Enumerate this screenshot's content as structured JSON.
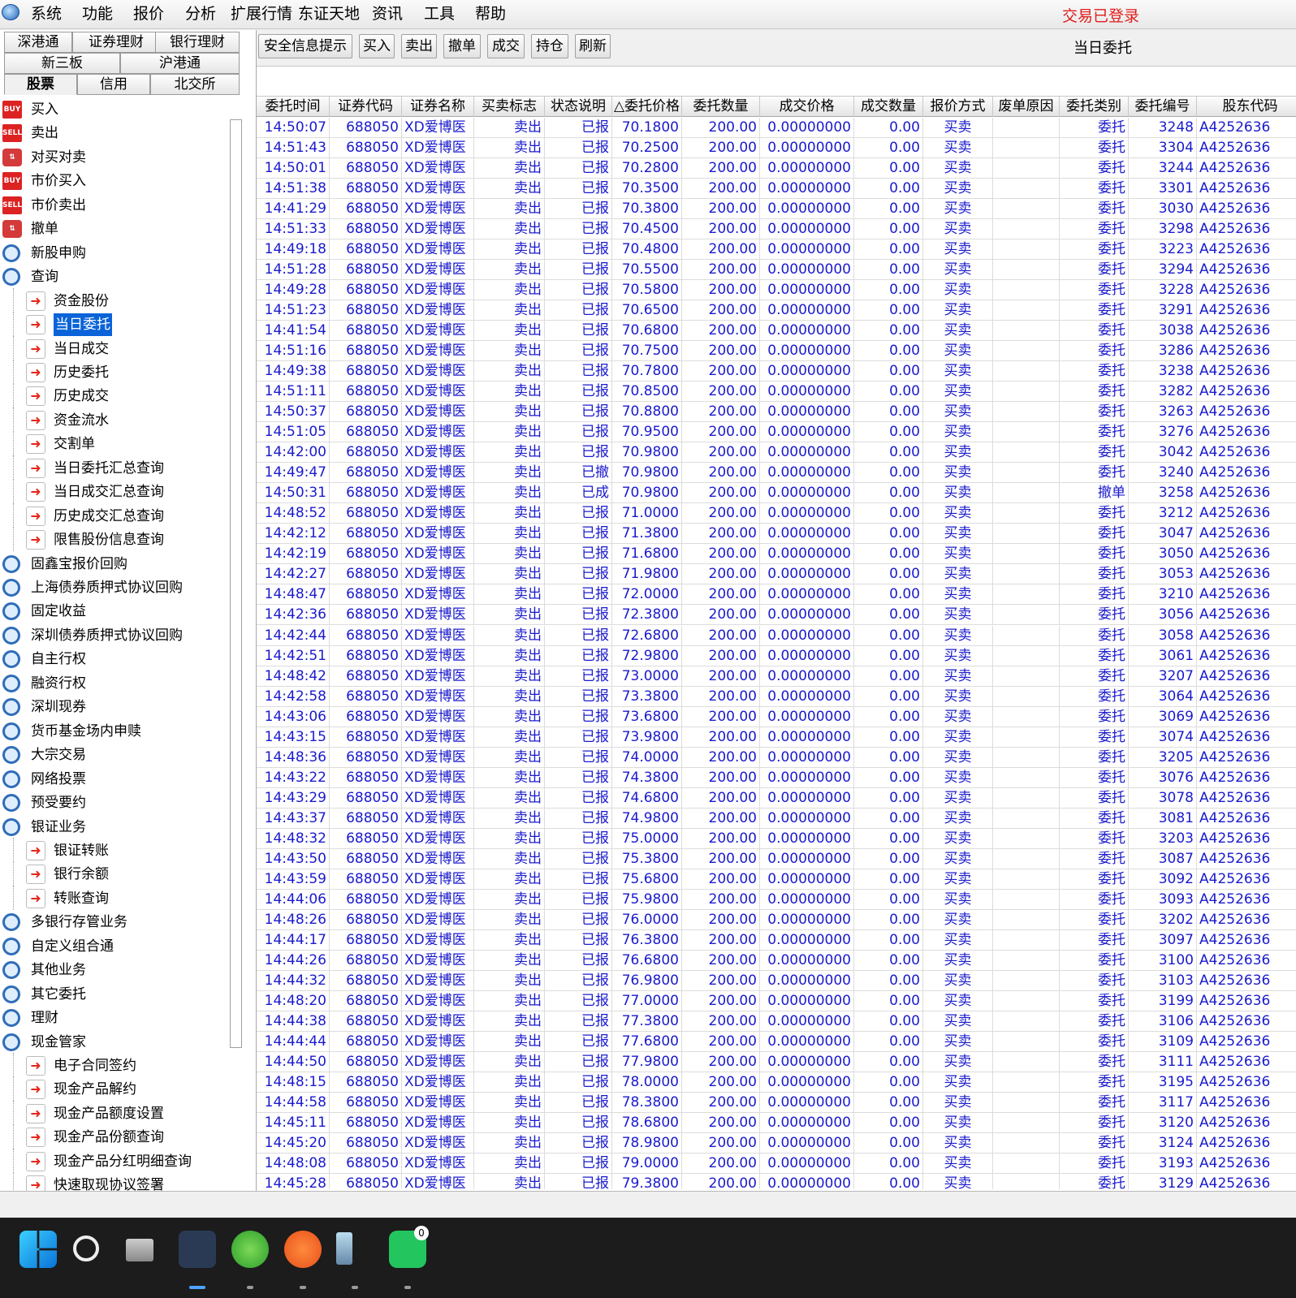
{
  "menu": {
    "items": [
      "系统",
      "功能",
      "报价",
      "分析",
      "扩展行情",
      "东证天地",
      "资讯",
      "工具",
      "帮助"
    ],
    "login_status": "交易已登录"
  },
  "tabs": {
    "row1": [
      "深港通",
      "证券理财",
      "银行理财"
    ],
    "row2": [
      "新三板",
      "沪港通"
    ],
    "row3": [
      "股票",
      "信用",
      "北交所"
    ],
    "active": "股票"
  },
  "tree": [
    {
      "label": "买入",
      "icon": "buy",
      "level": 0
    },
    {
      "label": "卖出",
      "icon": "sell",
      "level": 0
    },
    {
      "label": "对买对卖",
      "icon": "other",
      "level": 0
    },
    {
      "label": "市价买入",
      "icon": "buy",
      "level": 0
    },
    {
      "label": "市价卖出",
      "icon": "sell",
      "level": 0
    },
    {
      "label": "撤单",
      "icon": "other",
      "level": 0
    },
    {
      "label": "新股申购",
      "icon": "mag",
      "level": 0
    },
    {
      "label": "查询",
      "icon": "mag",
      "level": 0
    },
    {
      "label": "资金股份",
      "icon": "arrow",
      "level": 1
    },
    {
      "label": "当日委托",
      "icon": "arrow",
      "level": 1,
      "selected": true
    },
    {
      "label": "当日成交",
      "icon": "arrow",
      "level": 1
    },
    {
      "label": "历史委托",
      "icon": "arrow",
      "level": 1
    },
    {
      "label": "历史成交",
      "icon": "arrow",
      "level": 1
    },
    {
      "label": "资金流水",
      "icon": "arrow",
      "level": 1
    },
    {
      "label": "交割单",
      "icon": "arrow",
      "level": 1
    },
    {
      "label": "当日委托汇总查询",
      "icon": "arrow",
      "level": 1
    },
    {
      "label": "当日成交汇总查询",
      "icon": "arrow",
      "level": 1
    },
    {
      "label": "历史成交汇总查询",
      "icon": "arrow",
      "level": 1
    },
    {
      "label": "限售股份信息查询",
      "icon": "arrow",
      "level": 1
    },
    {
      "label": "固鑫宝报价回购",
      "icon": "mag",
      "level": 0
    },
    {
      "label": "上海债券质押式协议回购",
      "icon": "mag",
      "level": 0
    },
    {
      "label": "固定收益",
      "icon": "mag",
      "level": 0
    },
    {
      "label": "深圳债券质押式协议回购",
      "icon": "mag",
      "level": 0
    },
    {
      "label": "自主行权",
      "icon": "mag",
      "level": 0
    },
    {
      "label": "融资行权",
      "icon": "mag",
      "level": 0
    },
    {
      "label": "深圳现券",
      "icon": "mag",
      "level": 0
    },
    {
      "label": "货币基金场内申赎",
      "icon": "mag",
      "level": 0
    },
    {
      "label": "大宗交易",
      "icon": "mag",
      "level": 0
    },
    {
      "label": "网络投票",
      "icon": "mag",
      "level": 0
    },
    {
      "label": "预受要约",
      "icon": "mag",
      "level": 0
    },
    {
      "label": "银证业务",
      "icon": "mag",
      "level": 0
    },
    {
      "label": "银证转账",
      "icon": "arrow",
      "level": 1
    },
    {
      "label": "银行余额",
      "icon": "arrow",
      "level": 1
    },
    {
      "label": "转账查询",
      "icon": "arrow",
      "level": 1
    },
    {
      "label": "多银行存管业务",
      "icon": "mag",
      "level": 0
    },
    {
      "label": "自定义组合通",
      "icon": "mag",
      "level": 0
    },
    {
      "label": "其他业务",
      "icon": "mag",
      "level": 0
    },
    {
      "label": "其它委托",
      "icon": "mag",
      "level": 0
    },
    {
      "label": "理财",
      "icon": "mag",
      "level": 0
    },
    {
      "label": "现金管家",
      "icon": "mag",
      "level": 0
    },
    {
      "label": "电子合同签约",
      "icon": "arrow",
      "level": 1
    },
    {
      "label": "现金产品解约",
      "icon": "arrow",
      "level": 1
    },
    {
      "label": "现金产品额度设置",
      "icon": "arrow",
      "level": 1
    },
    {
      "label": "现金产品份额查询",
      "icon": "arrow",
      "level": 1
    },
    {
      "label": "现金产品分红明细查询",
      "icon": "arrow",
      "level": 1
    },
    {
      "label": "快速取现协议签署",
      "icon": "arrow",
      "level": 1
    }
  ],
  "toolbar": {
    "buttons": [
      "安全信息提示",
      "买入",
      "卖出",
      "撤单",
      "成交",
      "持仓",
      "刷新"
    ],
    "title": "当日委托"
  },
  "table": {
    "headers": [
      "委托时间",
      "证券代码",
      "证券名称",
      "买卖标志",
      "状态说明",
      "△委托价格",
      "委托数量",
      "成交价格",
      "成交数量",
      "报价方式",
      "废单原因",
      "委托类别",
      "委托编号",
      "股东代码"
    ],
    "rows": [
      [
        "14:50:07",
        "688050",
        "XD爱博医",
        "卖出",
        "已报",
        "70.1800",
        "200.00",
        "0.00000000",
        "0.00",
        "买卖",
        "",
        "委托",
        "3248",
        "A4252636"
      ],
      [
        "14:51:43",
        "688050",
        "XD爱博医",
        "卖出",
        "已报",
        "70.2500",
        "200.00",
        "0.00000000",
        "0.00",
        "买卖",
        "",
        "委托",
        "3304",
        "A4252636"
      ],
      [
        "14:50:01",
        "688050",
        "XD爱博医",
        "卖出",
        "已报",
        "70.2800",
        "200.00",
        "0.00000000",
        "0.00",
        "买卖",
        "",
        "委托",
        "3244",
        "A4252636"
      ],
      [
        "14:51:38",
        "688050",
        "XD爱博医",
        "卖出",
        "已报",
        "70.3500",
        "200.00",
        "0.00000000",
        "0.00",
        "买卖",
        "",
        "委托",
        "3301",
        "A4252636"
      ],
      [
        "14:41:29",
        "688050",
        "XD爱博医",
        "卖出",
        "已报",
        "70.3800",
        "200.00",
        "0.00000000",
        "0.00",
        "买卖",
        "",
        "委托",
        "3030",
        "A4252636"
      ],
      [
        "14:51:33",
        "688050",
        "XD爱博医",
        "卖出",
        "已报",
        "70.4500",
        "200.00",
        "0.00000000",
        "0.00",
        "买卖",
        "",
        "委托",
        "3298",
        "A4252636"
      ],
      [
        "14:49:18",
        "688050",
        "XD爱博医",
        "卖出",
        "已报",
        "70.4800",
        "200.00",
        "0.00000000",
        "0.00",
        "买卖",
        "",
        "委托",
        "3223",
        "A4252636"
      ],
      [
        "14:51:28",
        "688050",
        "XD爱博医",
        "卖出",
        "已报",
        "70.5500",
        "200.00",
        "0.00000000",
        "0.00",
        "买卖",
        "",
        "委托",
        "3294",
        "A4252636"
      ],
      [
        "14:49:28",
        "688050",
        "XD爱博医",
        "卖出",
        "已报",
        "70.5800",
        "200.00",
        "0.00000000",
        "0.00",
        "买卖",
        "",
        "委托",
        "3228",
        "A4252636"
      ],
      [
        "14:51:23",
        "688050",
        "XD爱博医",
        "卖出",
        "已报",
        "70.6500",
        "200.00",
        "0.00000000",
        "0.00",
        "买卖",
        "",
        "委托",
        "3291",
        "A4252636"
      ],
      [
        "14:41:54",
        "688050",
        "XD爱博医",
        "卖出",
        "已报",
        "70.6800",
        "200.00",
        "0.00000000",
        "0.00",
        "买卖",
        "",
        "委托",
        "3038",
        "A4252636"
      ],
      [
        "14:51:16",
        "688050",
        "XD爱博医",
        "卖出",
        "已报",
        "70.7500",
        "200.00",
        "0.00000000",
        "0.00",
        "买卖",
        "",
        "委托",
        "3286",
        "A4252636"
      ],
      [
        "14:49:38",
        "688050",
        "XD爱博医",
        "卖出",
        "已报",
        "70.7800",
        "200.00",
        "0.00000000",
        "0.00",
        "买卖",
        "",
        "委托",
        "3238",
        "A4252636"
      ],
      [
        "14:51:11",
        "688050",
        "XD爱博医",
        "卖出",
        "已报",
        "70.8500",
        "200.00",
        "0.00000000",
        "0.00",
        "买卖",
        "",
        "委托",
        "3282",
        "A4252636"
      ],
      [
        "14:50:37",
        "688050",
        "XD爱博医",
        "卖出",
        "已报",
        "70.8800",
        "200.00",
        "0.00000000",
        "0.00",
        "买卖",
        "",
        "委托",
        "3263",
        "A4252636"
      ],
      [
        "14:51:05",
        "688050",
        "XD爱博医",
        "卖出",
        "已报",
        "70.9500",
        "200.00",
        "0.00000000",
        "0.00",
        "买卖",
        "",
        "委托",
        "3276",
        "A4252636"
      ],
      [
        "14:42:00",
        "688050",
        "XD爱博医",
        "卖出",
        "已报",
        "70.9800",
        "200.00",
        "0.00000000",
        "0.00",
        "买卖",
        "",
        "委托",
        "3042",
        "A4252636"
      ],
      [
        "14:49:47",
        "688050",
        "XD爱博医",
        "卖出",
        "已撤",
        "70.9800",
        "200.00",
        "0.00000000",
        "0.00",
        "买卖",
        "",
        "委托",
        "3240",
        "A4252636"
      ],
      [
        "14:50:31",
        "688050",
        "XD爱博医",
        "卖出",
        "已成",
        "70.9800",
        "200.00",
        "0.00000000",
        "0.00",
        "买卖",
        "",
        "撤单",
        "3258",
        "A4252636"
      ],
      [
        "14:48:52",
        "688050",
        "XD爱博医",
        "卖出",
        "已报",
        "71.0000",
        "200.00",
        "0.00000000",
        "0.00",
        "买卖",
        "",
        "委托",
        "3212",
        "A4252636"
      ],
      [
        "14:42:12",
        "688050",
        "XD爱博医",
        "卖出",
        "已报",
        "71.3800",
        "200.00",
        "0.00000000",
        "0.00",
        "买卖",
        "",
        "委托",
        "3047",
        "A4252636"
      ],
      [
        "14:42:19",
        "688050",
        "XD爱博医",
        "卖出",
        "已报",
        "71.6800",
        "200.00",
        "0.00000000",
        "0.00",
        "买卖",
        "",
        "委托",
        "3050",
        "A4252636"
      ],
      [
        "14:42:27",
        "688050",
        "XD爱博医",
        "卖出",
        "已报",
        "71.9800",
        "200.00",
        "0.00000000",
        "0.00",
        "买卖",
        "",
        "委托",
        "3053",
        "A4252636"
      ],
      [
        "14:48:47",
        "688050",
        "XD爱博医",
        "卖出",
        "已报",
        "72.0000",
        "200.00",
        "0.00000000",
        "0.00",
        "买卖",
        "",
        "委托",
        "3210",
        "A4252636"
      ],
      [
        "14:42:36",
        "688050",
        "XD爱博医",
        "卖出",
        "已报",
        "72.3800",
        "200.00",
        "0.00000000",
        "0.00",
        "买卖",
        "",
        "委托",
        "3056",
        "A4252636"
      ],
      [
        "14:42:44",
        "688050",
        "XD爱博医",
        "卖出",
        "已报",
        "72.6800",
        "200.00",
        "0.00000000",
        "0.00",
        "买卖",
        "",
        "委托",
        "3058",
        "A4252636"
      ],
      [
        "14:42:51",
        "688050",
        "XD爱博医",
        "卖出",
        "已报",
        "72.9800",
        "200.00",
        "0.00000000",
        "0.00",
        "买卖",
        "",
        "委托",
        "3061",
        "A4252636"
      ],
      [
        "14:48:42",
        "688050",
        "XD爱博医",
        "卖出",
        "已报",
        "73.0000",
        "200.00",
        "0.00000000",
        "0.00",
        "买卖",
        "",
        "委托",
        "3207",
        "A4252636"
      ],
      [
        "14:42:58",
        "688050",
        "XD爱博医",
        "卖出",
        "已报",
        "73.3800",
        "200.00",
        "0.00000000",
        "0.00",
        "买卖",
        "",
        "委托",
        "3064",
        "A4252636"
      ],
      [
        "14:43:06",
        "688050",
        "XD爱博医",
        "卖出",
        "已报",
        "73.6800",
        "200.00",
        "0.00000000",
        "0.00",
        "买卖",
        "",
        "委托",
        "3069",
        "A4252636"
      ],
      [
        "14:43:15",
        "688050",
        "XD爱博医",
        "卖出",
        "已报",
        "73.9800",
        "200.00",
        "0.00000000",
        "0.00",
        "买卖",
        "",
        "委托",
        "3074",
        "A4252636"
      ],
      [
        "14:48:36",
        "688050",
        "XD爱博医",
        "卖出",
        "已报",
        "74.0000",
        "200.00",
        "0.00000000",
        "0.00",
        "买卖",
        "",
        "委托",
        "3205",
        "A4252636"
      ],
      [
        "14:43:22",
        "688050",
        "XD爱博医",
        "卖出",
        "已报",
        "74.3800",
        "200.00",
        "0.00000000",
        "0.00",
        "买卖",
        "",
        "委托",
        "3076",
        "A4252636"
      ],
      [
        "14:43:29",
        "688050",
        "XD爱博医",
        "卖出",
        "已报",
        "74.6800",
        "200.00",
        "0.00000000",
        "0.00",
        "买卖",
        "",
        "委托",
        "3078",
        "A4252636"
      ],
      [
        "14:43:37",
        "688050",
        "XD爱博医",
        "卖出",
        "已报",
        "74.9800",
        "200.00",
        "0.00000000",
        "0.00",
        "买卖",
        "",
        "委托",
        "3081",
        "A4252636"
      ],
      [
        "14:48:32",
        "688050",
        "XD爱博医",
        "卖出",
        "已报",
        "75.0000",
        "200.00",
        "0.00000000",
        "0.00",
        "买卖",
        "",
        "委托",
        "3203",
        "A4252636"
      ],
      [
        "14:43:50",
        "688050",
        "XD爱博医",
        "卖出",
        "已报",
        "75.3800",
        "200.00",
        "0.00000000",
        "0.00",
        "买卖",
        "",
        "委托",
        "3087",
        "A4252636"
      ],
      [
        "14:43:59",
        "688050",
        "XD爱博医",
        "卖出",
        "已报",
        "75.6800",
        "200.00",
        "0.00000000",
        "0.00",
        "买卖",
        "",
        "委托",
        "3092",
        "A4252636"
      ],
      [
        "14:44:06",
        "688050",
        "XD爱博医",
        "卖出",
        "已报",
        "75.9800",
        "200.00",
        "0.00000000",
        "0.00",
        "买卖",
        "",
        "委托",
        "3093",
        "A4252636"
      ],
      [
        "14:48:26",
        "688050",
        "XD爱博医",
        "卖出",
        "已报",
        "76.0000",
        "200.00",
        "0.00000000",
        "0.00",
        "买卖",
        "",
        "委托",
        "3202",
        "A4252636"
      ],
      [
        "14:44:17",
        "688050",
        "XD爱博医",
        "卖出",
        "已报",
        "76.3800",
        "200.00",
        "0.00000000",
        "0.00",
        "买卖",
        "",
        "委托",
        "3097",
        "A4252636"
      ],
      [
        "14:44:26",
        "688050",
        "XD爱博医",
        "卖出",
        "已报",
        "76.6800",
        "200.00",
        "0.00000000",
        "0.00",
        "买卖",
        "",
        "委托",
        "3100",
        "A4252636"
      ],
      [
        "14:44:32",
        "688050",
        "XD爱博医",
        "卖出",
        "已报",
        "76.9800",
        "200.00",
        "0.00000000",
        "0.00",
        "买卖",
        "",
        "委托",
        "3103",
        "A4252636"
      ],
      [
        "14:48:20",
        "688050",
        "XD爱博医",
        "卖出",
        "已报",
        "77.0000",
        "200.00",
        "0.00000000",
        "0.00",
        "买卖",
        "",
        "委托",
        "3199",
        "A4252636"
      ],
      [
        "14:44:38",
        "688050",
        "XD爱博医",
        "卖出",
        "已报",
        "77.3800",
        "200.00",
        "0.00000000",
        "0.00",
        "买卖",
        "",
        "委托",
        "3106",
        "A4252636"
      ],
      [
        "14:44:44",
        "688050",
        "XD爱博医",
        "卖出",
        "已报",
        "77.6800",
        "200.00",
        "0.00000000",
        "0.00",
        "买卖",
        "",
        "委托",
        "3109",
        "A4252636"
      ],
      [
        "14:44:50",
        "688050",
        "XD爱博医",
        "卖出",
        "已报",
        "77.9800",
        "200.00",
        "0.00000000",
        "0.00",
        "买卖",
        "",
        "委托",
        "3111",
        "A4252636"
      ],
      [
        "14:48:15",
        "688050",
        "XD爱博医",
        "卖出",
        "已报",
        "78.0000",
        "200.00",
        "0.00000000",
        "0.00",
        "买卖",
        "",
        "委托",
        "3195",
        "A4252636"
      ],
      [
        "14:44:58",
        "688050",
        "XD爱博医",
        "卖出",
        "已报",
        "78.3800",
        "200.00",
        "0.00000000",
        "0.00",
        "买卖",
        "",
        "委托",
        "3117",
        "A4252636"
      ],
      [
        "14:45:11",
        "688050",
        "XD爱博医",
        "卖出",
        "已报",
        "78.6800",
        "200.00",
        "0.00000000",
        "0.00",
        "买卖",
        "",
        "委托",
        "3120",
        "A4252636"
      ],
      [
        "14:45:20",
        "688050",
        "XD爱博医",
        "卖出",
        "已报",
        "78.9800",
        "200.00",
        "0.00000000",
        "0.00",
        "买卖",
        "",
        "委托",
        "3124",
        "A4252636"
      ],
      [
        "14:48:08",
        "688050",
        "XD爱博医",
        "卖出",
        "已报",
        "79.0000",
        "200.00",
        "0.00000000",
        "0.00",
        "买卖",
        "",
        "委托",
        "3193",
        "A4252636"
      ],
      [
        "14:45:28",
        "688050",
        "XD爱博医",
        "卖出",
        "已报",
        "79.3800",
        "200.00",
        "0.00000000",
        "0.00",
        "买卖",
        "",
        "委托",
        "3129",
        "A4252636"
      ]
    ]
  },
  "taskbar": {
    "icons": [
      "windows-start-icon",
      "search-icon",
      "task-view-icon",
      "trading-app-icon",
      "browser-icon",
      "feather-app-icon",
      "phone-app-icon",
      "wechat-icon"
    ],
    "wechat_badge": "0"
  }
}
